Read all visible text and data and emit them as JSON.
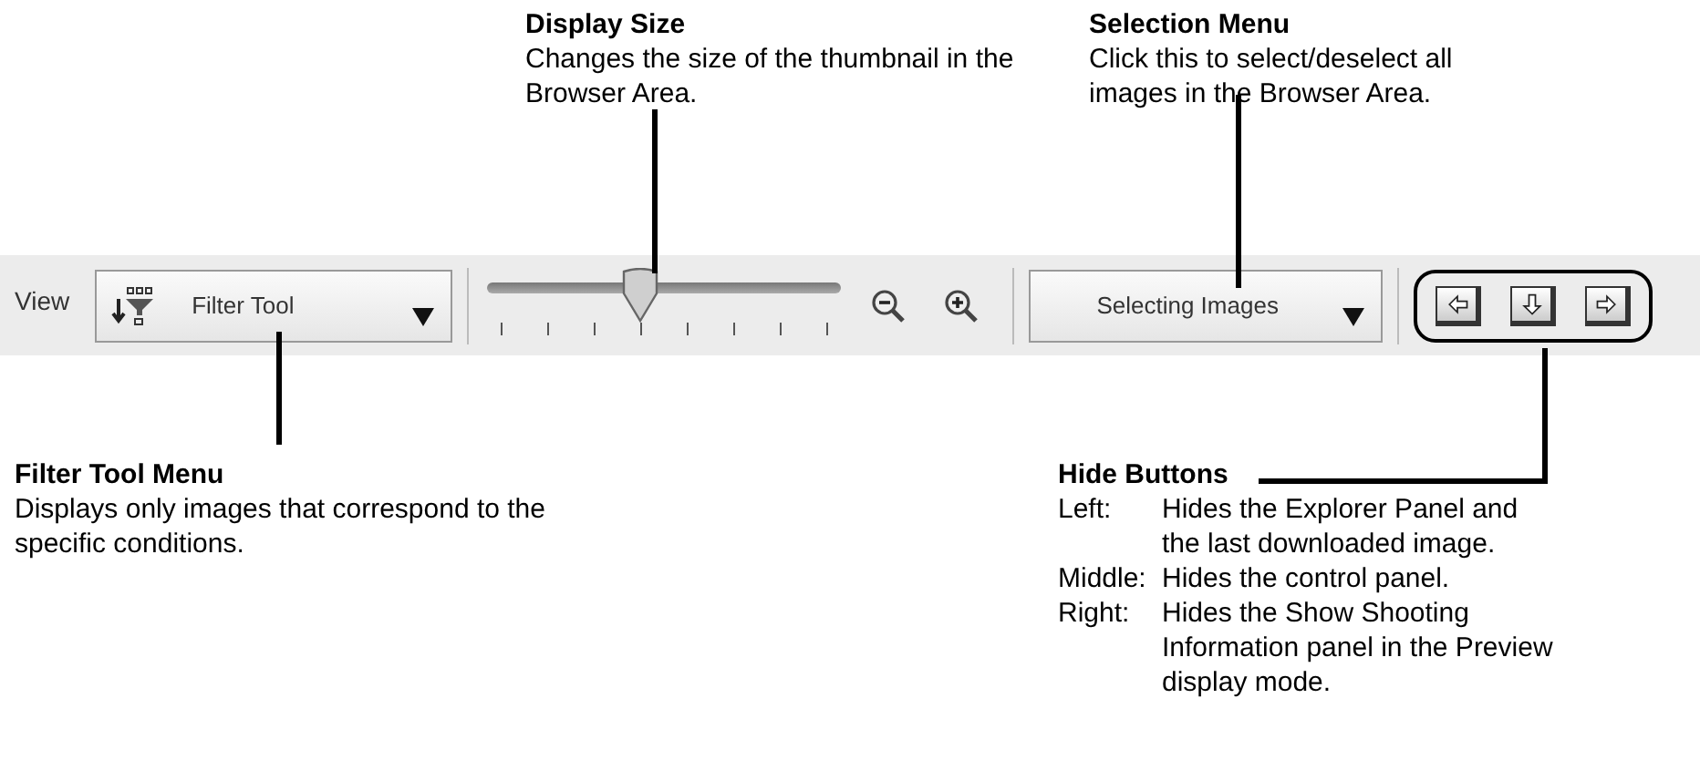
{
  "callouts_top": [
    {
      "title": "Display Size",
      "text": "Changes the size of the thumbnail in the Browser Area."
    },
    {
      "title": "Selection Menu",
      "text": "Click this to select/deselect all images in the Browser Area."
    }
  ],
  "toolbar": {
    "view_label": "View",
    "filter_dropdown": "Filter Tool",
    "slider": {
      "level": 0.43
    },
    "selection_dropdown": "Selecting Images",
    "hide_buttons": [
      {
        "kind": "left"
      },
      {
        "kind": "down"
      },
      {
        "kind": "right"
      }
    ]
  },
  "filter_callout": {
    "title": "Filter Tool Menu",
    "text": "Displays only images that correspond to the specific conditions."
  },
  "hide_callout": {
    "title": "Hide Buttons",
    "items": [
      {
        "label": "Left:",
        "text": "Hides the Explorer Panel and the last downloaded image."
      },
      {
        "label": "Middle:",
        "text": "Hides the control panel."
      },
      {
        "label": "Right:",
        "text": "Hides the Show Shooting Information panel in the Preview display mode."
      }
    ]
  }
}
